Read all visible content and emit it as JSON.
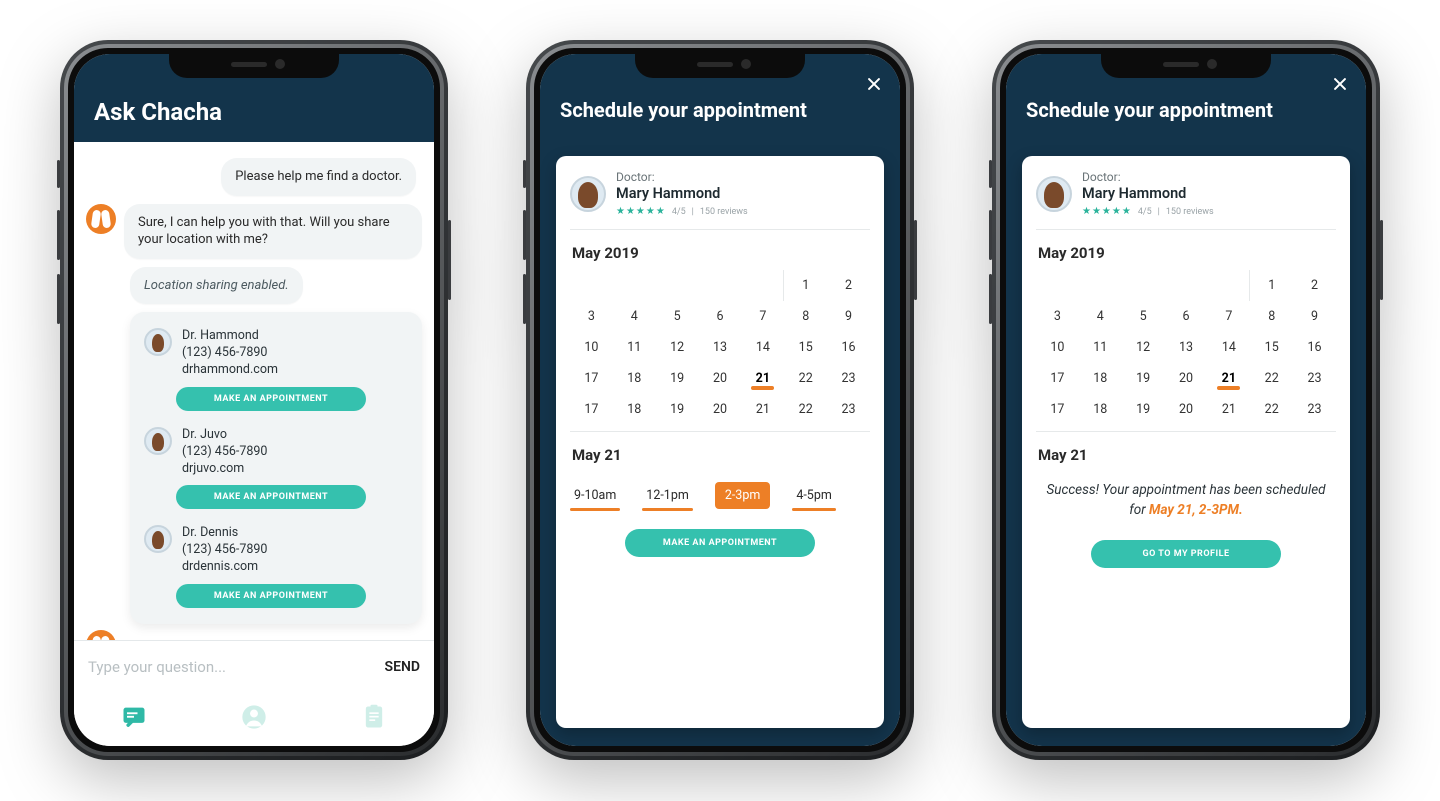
{
  "chat": {
    "title": "Ask Chacha",
    "messages": {
      "user1": "Please help me find a doctor.",
      "bot1": "Sure, I can help you with that. Will you share your location with me?",
      "system1": "Location sharing enabled."
    },
    "doctors": [
      {
        "name": "Dr. Hammond",
        "phone": "(123) 456-7890",
        "site": "drhammond.com"
      },
      {
        "name": "Dr. Juvo",
        "phone": "(123) 456-7890",
        "site": "drjuvo.com"
      },
      {
        "name": "Dr. Dennis",
        "phone": "(123) 456-7890",
        "site": "drdennis.com"
      }
    ],
    "appt_btn": "MAKE AN APPOINTMENT",
    "input_placeholder": "Type your question...",
    "send_label": "SEND"
  },
  "schedule": {
    "title": "Schedule your appointment",
    "doctor_label": "Doctor:",
    "doctor_name": "Mary Hammond",
    "rating_stars": "★★★★★",
    "rating_text": "4/5",
    "reviews_text": "150 reviews",
    "month_label": "May 2019",
    "calendar": {
      "row1": [
        "",
        "",
        "",
        "",
        "",
        "1",
        "2"
      ],
      "row2": [
        "3",
        "4",
        "5",
        "6",
        "7",
        "8",
        "9"
      ],
      "row3": [
        "10",
        "11",
        "12",
        "13",
        "14",
        "15",
        "16"
      ],
      "row4": [
        "17",
        "18",
        "19",
        "20",
        "21",
        "22",
        "23"
      ],
      "row5": [
        "17",
        "18",
        "19",
        "20",
        "21",
        "22",
        "23"
      ],
      "selected_day": "21"
    },
    "day_label": "May 21",
    "slots": [
      "9-10am",
      "12-1pm",
      "2-3pm",
      "4-5pm"
    ],
    "selected_slot": "2-3pm",
    "make_btn": "MAKE AN APPOINTMENT",
    "success_prefix": "Success! Your appointment has been scheduled for ",
    "success_highlight": "May 21, 2-3PM.",
    "profile_btn": "GO TO MY PROFILE"
  }
}
